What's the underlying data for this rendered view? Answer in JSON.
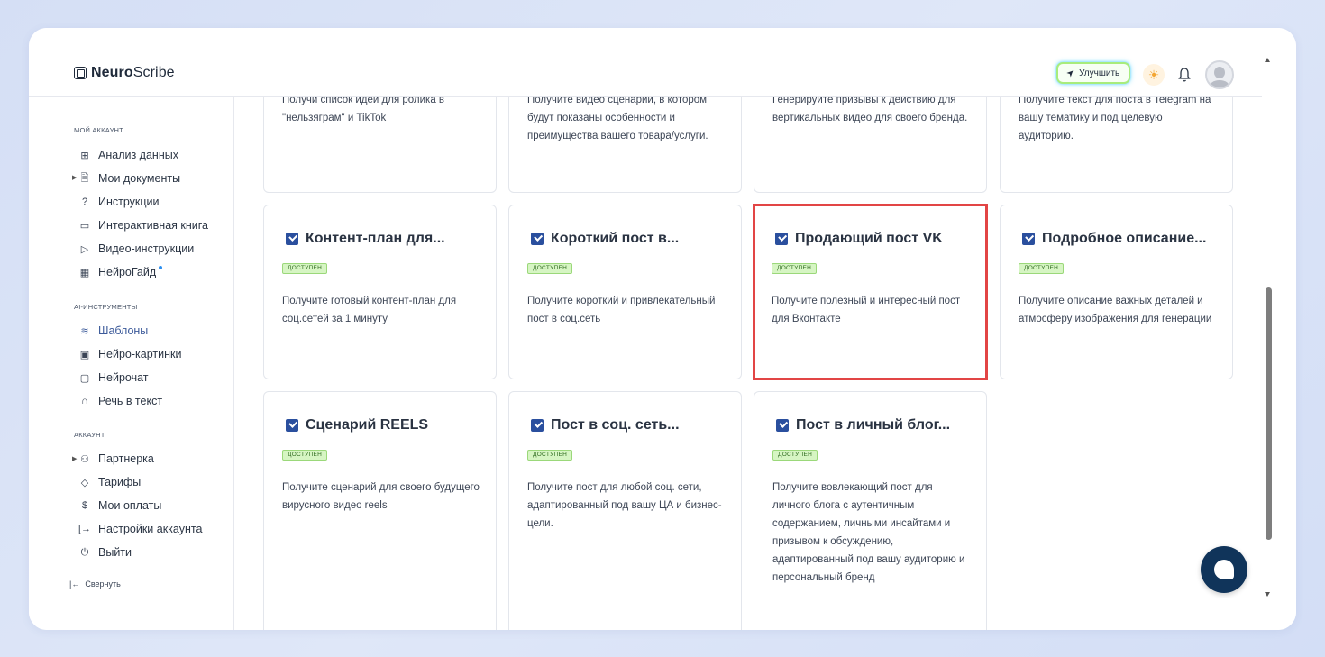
{
  "brand": {
    "bold": "Neuro",
    "light": "Scribe"
  },
  "header": {
    "upgrade_label": "Улучшить"
  },
  "sidebar": {
    "section_account": "МОЙ АККАУНТ",
    "account_items": [
      {
        "label": "Анализ данных",
        "icon": "grid-icon"
      },
      {
        "label": "Мои документы",
        "icon": "document-icon"
      },
      {
        "label": "Инструкции",
        "icon": "help-circle-icon"
      },
      {
        "label": "Интерактивная книга",
        "icon": "book-icon"
      },
      {
        "label": "Видео-инструкции",
        "icon": "video-icon"
      },
      {
        "label": "НейроГайд",
        "icon": "table-icon"
      }
    ],
    "section_ai": "AI-ИНСТРУМЕНТЫ",
    "ai_items": [
      {
        "label": "Шаблоны",
        "icon": "layers-icon"
      },
      {
        "label": "Нейро-картинки",
        "icon": "image-icon"
      },
      {
        "label": "Нейрочат",
        "icon": "chat-icon"
      },
      {
        "label": "Речь в текст",
        "icon": "headphones-icon"
      }
    ],
    "section_acc2": "АККАУНТ",
    "acc2_items": [
      {
        "label": "Партнерка",
        "icon": "users-icon"
      },
      {
        "label": "Тарифы",
        "icon": "tag-icon"
      },
      {
        "label": "Мои оплаты",
        "icon": "dollar-icon"
      },
      {
        "label": "Настройки аккаунта",
        "icon": "login-icon"
      },
      {
        "label": "Выйти",
        "icon": "power-icon"
      }
    ],
    "collapse_label": "Свернуть"
  },
  "cards_top": [
    {
      "desc": "Получи список идей для ролика в \"нельзяграм\" и TikTok"
    },
    {
      "desc": "Получите видео сценарии, в котором будут показаны особенности и преимущества вашего товара/услуги."
    },
    {
      "desc": "Генерируйте призывы к действию для вертикальных видео для своего бренда."
    },
    {
      "desc": "Получите текст для поста в Telegram на вашу тематику и под целевую аудиторию."
    }
  ],
  "cards_row2": [
    {
      "title": "Контент-план для...",
      "badge": "ДОСТУПЕН",
      "desc": "Получите готовый контент-план для соц.сетей за 1 минуту"
    },
    {
      "title": "Короткий пост в...",
      "badge": "ДОСТУПЕН",
      "desc": "Получите короткий и привлекательный пост в соц.сеть"
    },
    {
      "title": "Продающий пост VK",
      "badge": "ДОСТУПЕН",
      "desc": "Получите полезный и интересный пост для Вконтакте"
    },
    {
      "title": "Подробное описание...",
      "badge": "ДОСТУПЕН",
      "desc": "Получите описание важных деталей и атмосферу изображения для генерации"
    }
  ],
  "cards_row3": [
    {
      "title": "Сценарий REELS",
      "badge": "ДОСТУПЕН",
      "desc": "Получите сценарий для своего будущего вирусного видео reels"
    },
    {
      "title": "Пост в соц. сеть...",
      "badge": "ДОСТУПЕН",
      "desc": "Получите пост для любой соц. сети, адаптированный под вашу ЦА и бизнес-цели."
    },
    {
      "title": "Пост в личный блог...",
      "badge": "ДОСТУПЕН",
      "desc": "Получите вовлекающий пост для личного блога с аутентичным содержанием, личными инсайтами и призывом к обсуждению, адаптированный под вашу аудиторию и персональный бренд"
    }
  ],
  "colors": {
    "accent": "#2a4f9e",
    "badge_bg": "#d6f5c3",
    "highlight": "#e24545",
    "chat": "#10345a"
  }
}
